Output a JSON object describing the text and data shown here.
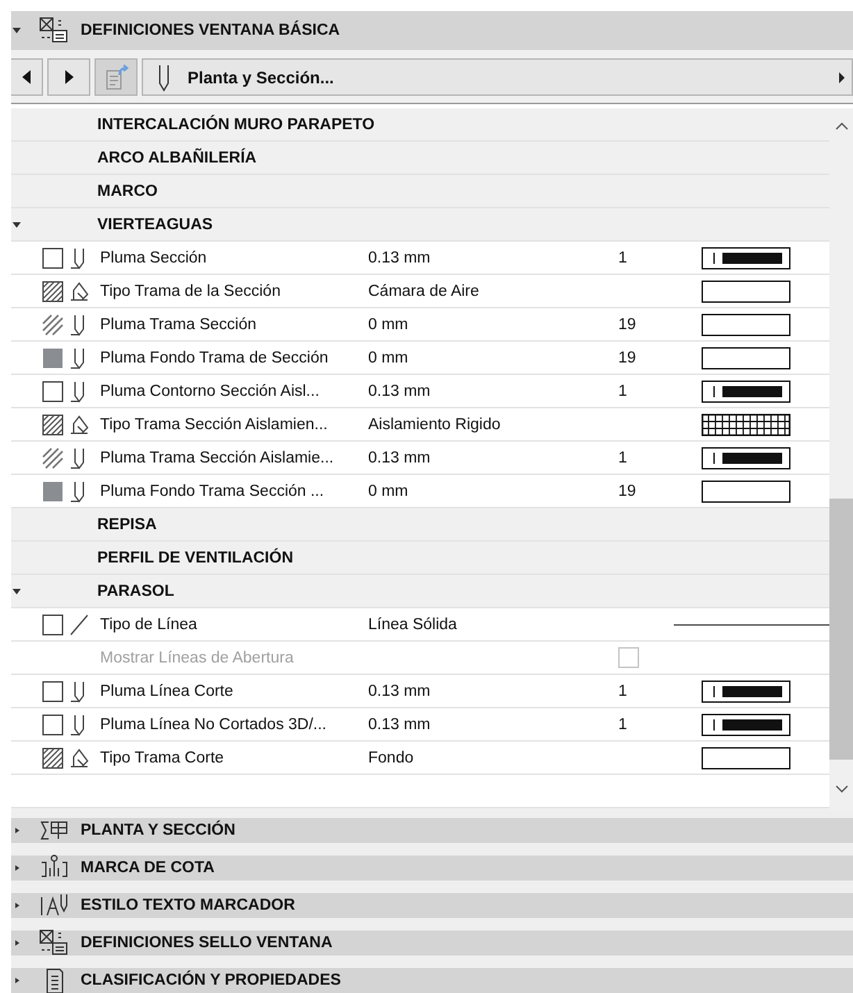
{
  "panel": {
    "title": "DEFINICIONES VENTANA BÁSICA",
    "expanded": true
  },
  "toolbar": {
    "dropdown": "Planta y Sección...",
    "share_disabled": true
  },
  "rows": [
    {
      "kind": "group",
      "label": "INTERCALACIÓN MURO PARAPETO",
      "expanded": false
    },
    {
      "kind": "group",
      "label": "ARCO ALBAÑILERÍA",
      "expanded": false
    },
    {
      "kind": "group",
      "label": "MARCO",
      "expanded": false
    },
    {
      "kind": "group",
      "label": "VIERTEAGUAS",
      "expanded": true
    },
    {
      "kind": "param",
      "swatch": {
        "kind": "outline"
      },
      "tool": {
        "kind": "pen"
      },
      "label": "Pluma Sección",
      "value": "0.13 mm",
      "number": "1",
      "preview": {
        "kind": "pen"
      }
    },
    {
      "kind": "param",
      "swatch": {
        "kind": "hatch"
      },
      "tool": {
        "kind": "fill"
      },
      "label": "Tipo Trama de la Sección",
      "value": "Cámara de Aire",
      "preview": {
        "kind": "blank"
      }
    },
    {
      "kind": "param",
      "swatch": {
        "kind": "diagonal"
      },
      "tool": {
        "kind": "pen"
      },
      "label": "Pluma Trama Sección",
      "value": "0 mm",
      "number": "19",
      "preview": {
        "kind": "blank"
      }
    },
    {
      "kind": "param",
      "swatch": {
        "kind": "solid"
      },
      "tool": {
        "kind": "pen"
      },
      "label": "Pluma Fondo Trama de Sección",
      "value": "0 mm",
      "number": "19",
      "preview": {
        "kind": "blank"
      }
    },
    {
      "kind": "param",
      "swatch": {
        "kind": "outline"
      },
      "tool": {
        "kind": "pen"
      },
      "label": "Pluma Contorno Sección Aisl...",
      "value": "0.13 mm",
      "number": "1",
      "preview": {
        "kind": "pen"
      }
    },
    {
      "kind": "param",
      "swatch": {
        "kind": "hatch"
      },
      "tool": {
        "kind": "fill"
      },
      "label": "Tipo Trama Sección Aislamien...",
      "value": "Aislamiento Rigido",
      "preview": {
        "kind": "grid"
      }
    },
    {
      "kind": "param",
      "swatch": {
        "kind": "diagonal"
      },
      "tool": {
        "kind": "pen"
      },
      "label": "Pluma Trama Sección Aislamie...",
      "value": "0.13 mm",
      "number": "1",
      "preview": {
        "kind": "pen"
      }
    },
    {
      "kind": "param",
      "swatch": {
        "kind": "solid"
      },
      "tool": {
        "kind": "pen"
      },
      "label": "Pluma Fondo Trama Sección ...",
      "value": "0 mm",
      "number": "19",
      "preview": {
        "kind": "blank"
      }
    },
    {
      "kind": "group",
      "label": "REPISA",
      "expanded": false
    },
    {
      "kind": "group",
      "label": "PERFIL DE VENTILACIÓN",
      "expanded": false
    },
    {
      "kind": "group",
      "label": "PARASOL",
      "expanded": true
    },
    {
      "kind": "param",
      "swatch": {
        "kind": "outline"
      },
      "tool": {
        "kind": "line"
      },
      "label": "Tipo de Línea",
      "value": "Línea Sólida",
      "preview": {
        "kind": "line"
      }
    },
    {
      "kind": "toggle",
      "label": "Mostrar Líneas de Abertura",
      "checked": false,
      "disabled": true
    },
    {
      "kind": "param",
      "swatch": {
        "kind": "outline"
      },
      "tool": {
        "kind": "pen"
      },
      "label": "Pluma Línea Corte",
      "value": "0.13 mm",
      "number": "1",
      "preview": {
        "kind": "pen"
      }
    },
    {
      "kind": "param",
      "swatch": {
        "kind": "outline"
      },
      "tool": {
        "kind": "pen"
      },
      "label": "Pluma Línea No Cortados 3D/...",
      "value": "0.13 mm",
      "number": "1",
      "preview": {
        "kind": "pen"
      }
    },
    {
      "kind": "param",
      "swatch": {
        "kind": "hatch"
      },
      "tool": {
        "kind": "fill"
      },
      "label": "Tipo Trama Corte",
      "value": "Fondo",
      "preview": {
        "kind": "blank"
      }
    }
  ],
  "sections": [
    {
      "label": "PLANTA Y SECCIÓN",
      "expanded": false
    },
    {
      "label": "MARCA DE COTA",
      "expanded": false
    },
    {
      "label": "ESTILO TEXTO MARCADOR",
      "expanded": false
    },
    {
      "label": "DEFINICIONES SELLO VENTANA",
      "expanded": false
    },
    {
      "label": "CLASIFICACIÓN Y PROPIEDADES",
      "expanded": false
    }
  ]
}
